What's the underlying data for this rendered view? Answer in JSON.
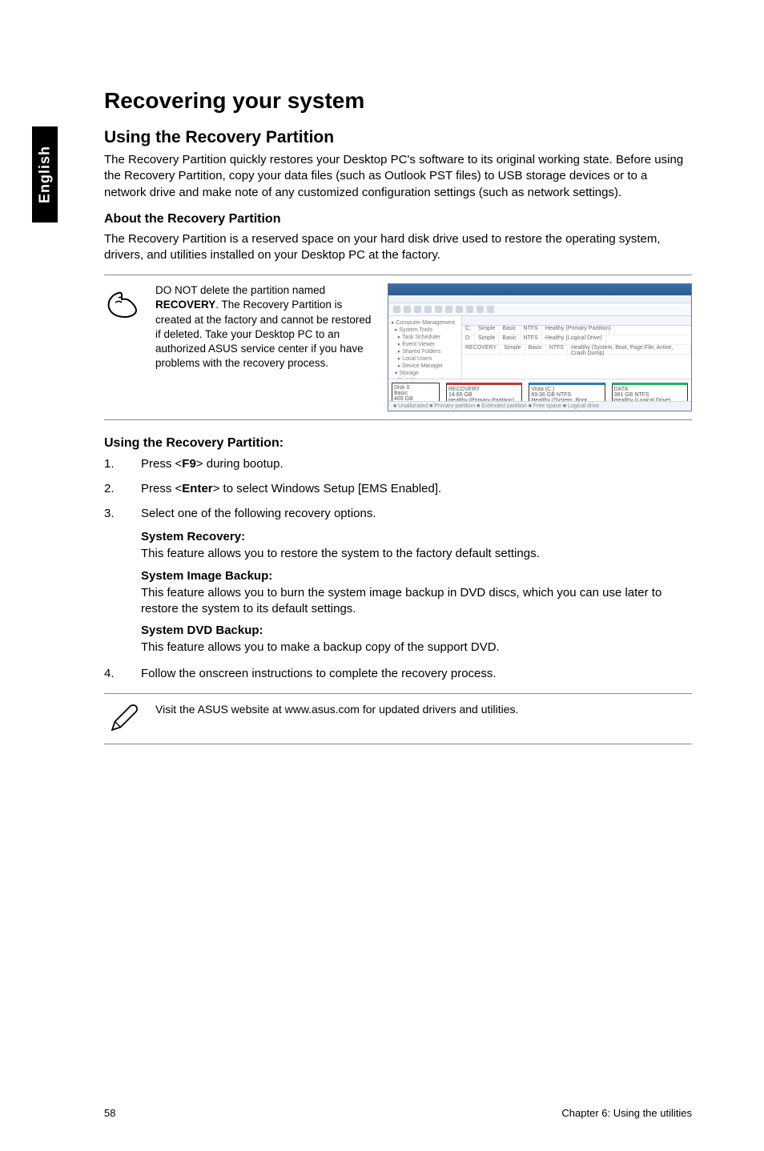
{
  "sideTab": "English",
  "h1": "Recovering your system",
  "h2": "Using the Recovery Partition",
  "intro": "The Recovery Partition quickly restores your Desktop PC's software to its original working state. Before using the Recovery Partition, copy your data files (such as Outlook PST files) to USB storage devices or to a network drive and make note of any customized configuration settings (such as network settings).",
  "aboutH": "About the Recovery Partition",
  "aboutP": "The Recovery Partition is a reserved space on your hard disk drive used to restore the operating system, drivers, and utilities installed on your Desktop PC at the factory.",
  "warnNote": {
    "pre": "DO NOT delete the partition named ",
    "bold": "RECOVERY",
    "post": ". The Recovery Partition is created at the factory and cannot be restored if deleted. Take your Desktop PC to an authorized ASUS service center if you have problems with the recovery process."
  },
  "useH": "Using the Recovery Partition:",
  "steps": {
    "s1": {
      "pre": "Press <",
      "key": "F9",
      "post": "> during bootup."
    },
    "s2": {
      "pre": "Press <",
      "key": "Enter",
      "post": "> to select Windows Setup [EMS Enabled]."
    },
    "s3": "Select one of the following recovery options.",
    "sysRecH": "System Recovery:",
    "sysRecP": "This feature allows you to restore the system to the factory default settings.",
    "imgH": "System Image Backup:",
    "imgP": "This feature allows you to burn the system image backup in DVD discs, which you can use later to restore the system to its default settings.",
    "dvdH": "System DVD Backup:",
    "dvdP": "This feature allows you to make a backup copy of the support DVD.",
    "s4": "Follow the onscreen instructions to complete the recovery process."
  },
  "visitNote": "Visit the ASUS website at www.asus.com for updated drivers and utilities.",
  "footerLeft": "58",
  "footerRight": "Chapter 6: Using the utilities"
}
